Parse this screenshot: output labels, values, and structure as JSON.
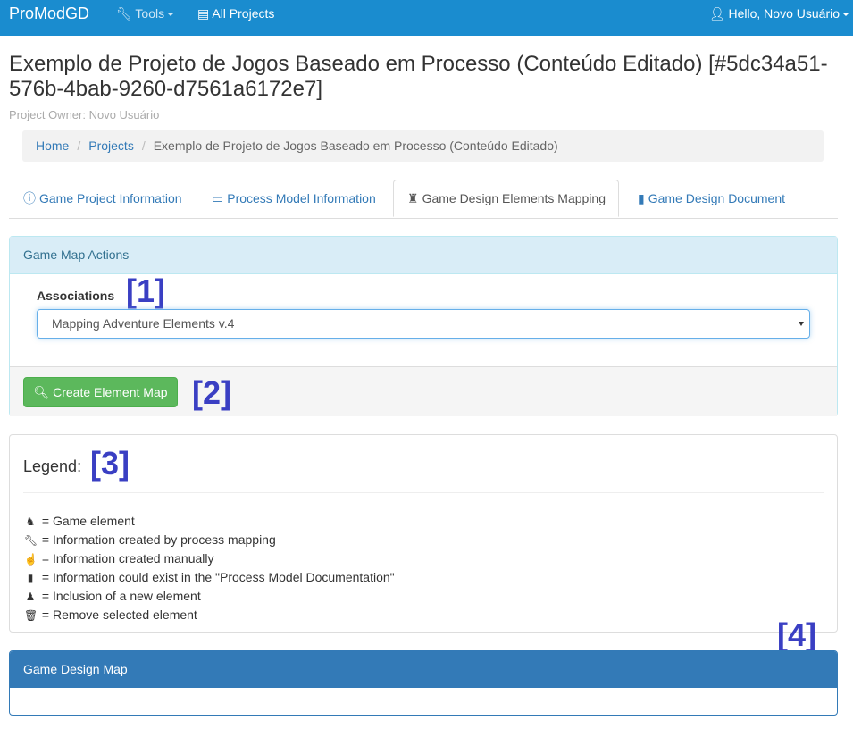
{
  "navbar": {
    "brand": "ProModGD",
    "tools_label": "Tools",
    "projects_label": "All Projects",
    "user_label": "Hello, Novo Usuário",
    "bg_color": "#1a8ccf"
  },
  "page": {
    "title": "Exemplo de Projeto de Jogos Baseado em Processo (Conteúdo Editado) [#5dc34a51-576b-4bab-9260-d7561a6172e7]",
    "owner": "Project Owner: Novo Usuário"
  },
  "breadcrumb": {
    "home": "Home",
    "projects": "Projects",
    "current": "Exemplo de Projeto de Jogos Baseado em Processo (Conteúdo Editado)"
  },
  "tabs": [
    {
      "label": "Game Project Information",
      "icon": "info-circle-icon"
    },
    {
      "label": "Process Model Information",
      "icon": "hdd-icon"
    },
    {
      "label": "Game Design Elements Mapping",
      "icon": "chess-tower-icon",
      "active": true
    },
    {
      "label": "Game Design Document",
      "icon": "book-icon"
    }
  ],
  "actions_panel": {
    "heading": "Game Map Actions",
    "associations_label": "Associations",
    "select_value": "Mapping Adventure Elements v.4",
    "create_button": "Create Element Map"
  },
  "legend_panel": {
    "heading": "Legend:",
    "items": [
      {
        "icon": "chess-knight-icon",
        "text": "= Game element"
      },
      {
        "icon": "wrench-icon",
        "text": "= Information created by process mapping"
      },
      {
        "icon": "hand-up-icon",
        "text": "= Information created manually"
      },
      {
        "icon": "book-icon",
        "text": "= Information could exist in the \"Process Model Documentation\""
      },
      {
        "icon": "chess-pawn-icon",
        "text": "= Inclusion of a new element"
      },
      {
        "icon": "trash-icon",
        "text": "= Remove selected element"
      }
    ]
  },
  "map_panel": {
    "heading": "Game Design Map"
  },
  "markers": {
    "m1": "[1]",
    "m2": "[2]",
    "m3": "[3]",
    "m4": "[4]"
  }
}
